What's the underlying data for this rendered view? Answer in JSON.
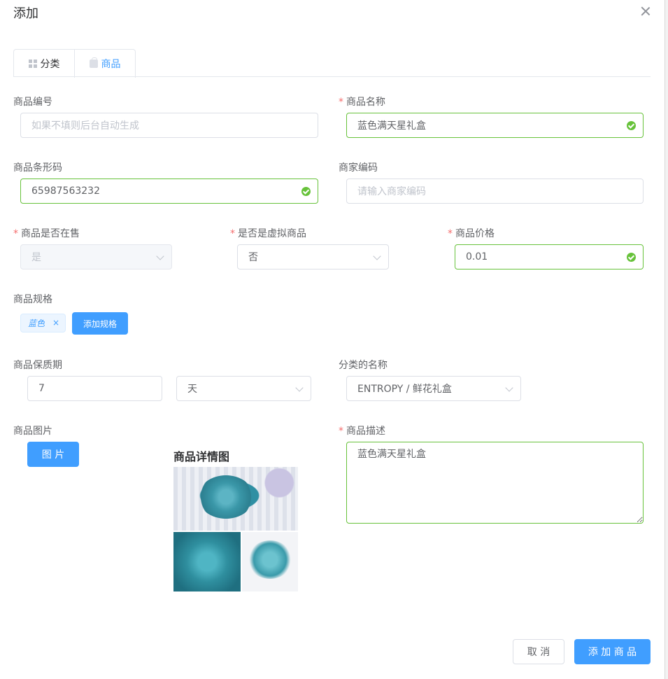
{
  "dialog": {
    "title": "添加"
  },
  "tabs": [
    {
      "label": "分类",
      "icon": "grid-icon",
      "active": false
    },
    {
      "label": "商品",
      "icon": "bag-icon",
      "active": true
    }
  ],
  "form": {
    "product_no": {
      "label": "商品编号",
      "placeholder": "如果不填则后台自动生成",
      "value": ""
    },
    "product_name": {
      "label": "商品名称",
      "value": "蓝色满天星礼盒",
      "required": true
    },
    "barcode": {
      "label": "商品条形码",
      "value": "65987563232"
    },
    "merchant_code": {
      "label": "商家编码",
      "placeholder": "请输入商家编码",
      "value": ""
    },
    "on_sale": {
      "label": "商品是否在售",
      "value": "是",
      "required": true,
      "disabled": true
    },
    "virtual": {
      "label": "是否是虚拟商品",
      "value": "否",
      "required": true
    },
    "price": {
      "label": "商品价格",
      "value": "0.01",
      "required": true
    },
    "spec": {
      "label": "商品规格",
      "tags": [
        "蓝色"
      ],
      "add_label": "添加规格"
    },
    "shelf_life": {
      "label": "商品保质期",
      "value": "7",
      "unit": "天"
    },
    "category": {
      "label": "分类的名称",
      "value": "ENTROPY / 鲜花礼盒"
    },
    "image": {
      "label": "商品图片",
      "button_label": "图 片",
      "detail_title": "商品详情图"
    },
    "description": {
      "label": "商品描述",
      "value": "蓝色满天星礼盒",
      "required": true
    }
  },
  "footer": {
    "cancel_label": "取 消",
    "submit_label": "添 加 商 品"
  },
  "colors": {
    "primary": "#409eff",
    "success": "#67c23a",
    "required": "#f56c6c"
  }
}
